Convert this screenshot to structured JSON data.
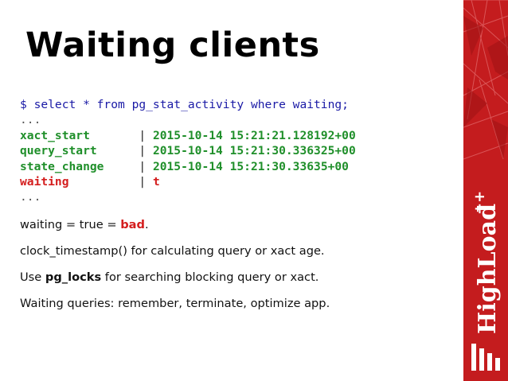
{
  "slide": {
    "title": "Waiting clients",
    "code": {
      "query": "$ select * from pg_stat_activity where waiting;",
      "ellipsis_top": "...",
      "rows": [
        {
          "key": "xact_start      ",
          "sep": " | ",
          "value": "2015-10-14 15:21:21.128192+00",
          "style": "green"
        },
        {
          "key": "query_start     ",
          "sep": " | ",
          "value": "2015-10-14 15:21:30.336325+00",
          "style": "green"
        },
        {
          "key": "state_change    ",
          "sep": " | ",
          "value": "2015-10-14 15:21:30.33635+00",
          "style": "green"
        },
        {
          "key": "waiting         ",
          "sep": " | ",
          "value": "t",
          "style": "red"
        }
      ],
      "ellipsis_bottom": "..."
    },
    "bullets": {
      "b1_prefix": "waiting = true = ",
      "b1_bad": "bad",
      "b1_suffix": ".",
      "b2": "clock_timestamp() for calculating query or xact age.",
      "b3_prefix": "Use ",
      "b3_bold": "pg_locks",
      "b3_suffix": " for searching blocking query or xact.",
      "b4": "Waiting queries: remember, terminate, optimize app."
    },
    "brand": {
      "name": "HighLoad",
      "superscript": "++",
      "color": "#c41c1e",
      "logo_icon": "highload-logo-icon"
    }
  }
}
